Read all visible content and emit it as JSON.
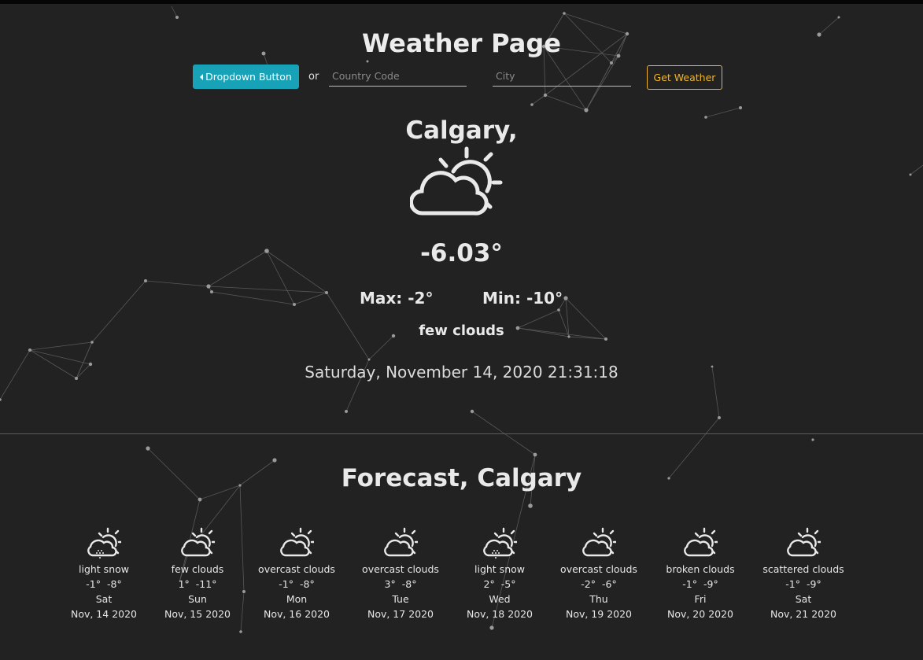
{
  "page": {
    "title": "Weather Page"
  },
  "search": {
    "dropdown_label": "Dropdown Button",
    "or_label": "or",
    "country_placeholder": "Country Code",
    "country_value": "",
    "city_placeholder": "City",
    "city_value": "",
    "submit_label": "Get Weather"
  },
  "current": {
    "city": "Calgary,",
    "icon": "partly-cloudy-icon",
    "temp": "-6.03°",
    "max": "Max: -2°",
    "min": "Min: -10°",
    "description": "few clouds",
    "datetime": "Saturday, November 14, 2020 21:31:18"
  },
  "forecast": {
    "title": "Forecast, Calgary",
    "days": [
      {
        "icon": "snow-sun-icon",
        "desc": "light snow",
        "max": "-1°",
        "min": "-8°",
        "day": "Sat",
        "date": "Nov, 14 2020"
      },
      {
        "icon": "partly-cloudy-icon",
        "desc": "few clouds",
        "max": "1°",
        "min": "-11°",
        "day": "Sun",
        "date": "Nov, 15 2020"
      },
      {
        "icon": "partly-cloudy-icon",
        "desc": "overcast clouds",
        "max": "-1°",
        "min": "-8°",
        "day": "Mon",
        "date": "Nov, 16 2020"
      },
      {
        "icon": "partly-cloudy-icon",
        "desc": "overcast clouds",
        "max": "3°",
        "min": "-8°",
        "day": "Tue",
        "date": "Nov, 17 2020"
      },
      {
        "icon": "snow-sun-icon",
        "desc": "light snow",
        "max": "2°",
        "min": "-5°",
        "day": "Wed",
        "date": "Nov, 18 2020"
      },
      {
        "icon": "partly-cloudy-icon",
        "desc": "overcast clouds",
        "max": "-2°",
        "min": "-6°",
        "day": "Thu",
        "date": "Nov, 19 2020"
      },
      {
        "icon": "partly-cloudy-icon",
        "desc": "broken clouds",
        "max": "-1°",
        "min": "-9°",
        "day": "Fri",
        "date": "Nov, 20 2020"
      },
      {
        "icon": "partly-cloudy-icon",
        "desc": "scattered clouds",
        "max": "-1°",
        "min": "-9°",
        "day": "Sat",
        "date": "Nov, 21 2020"
      }
    ]
  },
  "colors": {
    "background": "#222222",
    "accent_button": "#17a2b8",
    "submit_outline": "#f0b429",
    "text": "#e9e9e9"
  }
}
